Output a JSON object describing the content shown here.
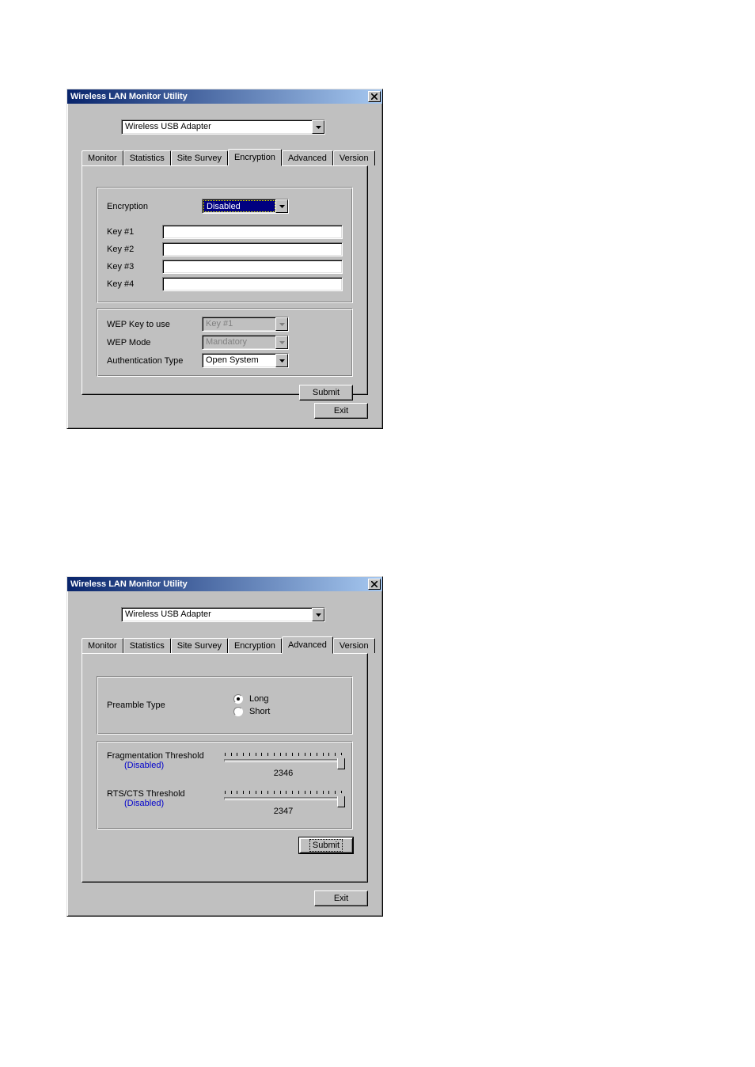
{
  "window1": {
    "title": "Wireless LAN Monitor Utility",
    "adapter": "Wireless USB Adapter",
    "tabs": [
      "Monitor",
      "Statistics",
      "Site Survey",
      "Encryption",
      "Advanced",
      "Version"
    ],
    "active_tab": "Encryption",
    "encryption_label": "Encryption",
    "encryption_value": "Disabled",
    "key_labels": [
      "Key #1",
      "Key #2",
      "Key #3",
      "Key #4"
    ],
    "wep_key_label": "WEP Key to use",
    "wep_key_value": "Key #1",
    "wep_mode_label": "WEP Mode",
    "wep_mode_value": "Mandatory",
    "auth_label": "Authentication Type",
    "auth_value": "Open System",
    "submit": "Submit",
    "exit": "Exit"
  },
  "window2": {
    "title": "Wireless LAN Monitor Utility",
    "adapter": "Wireless USB Adapter",
    "tabs": [
      "Monitor",
      "Statistics",
      "Site Survey",
      "Encryption",
      "Advanced",
      "Version"
    ],
    "active_tab": "Advanced",
    "preamble_label": "Preamble Type",
    "preamble_options": {
      "long": "Long",
      "short": "Short"
    },
    "preamble_selected": "long",
    "frag_label": "Fragmentation Threshold",
    "frag_note": "(Disabled)",
    "frag_value": "2346",
    "rts_label": "RTS/CTS Threshold",
    "rts_note": "(Disabled)",
    "rts_value": "2347",
    "submit": "Submit",
    "exit": "Exit"
  }
}
